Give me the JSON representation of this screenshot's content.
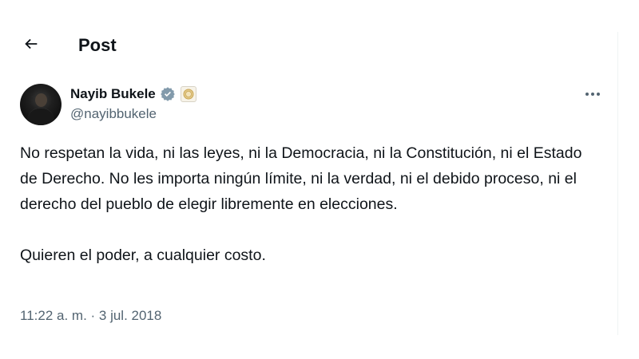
{
  "header": {
    "back_icon": "arrow-left-icon",
    "title": "Post"
  },
  "author": {
    "display_name": "Nayib Bukele",
    "handle": "@nayibbukele",
    "verified_icon": "verified-badge-icon",
    "verified_color": "#829aab",
    "affiliate_badge_icon": "affiliate-badge-icon"
  },
  "menu": {
    "more_icon": "more-horizontal-icon"
  },
  "tweet": {
    "paragraphs": [
      "No respetan la vida, ni las leyes, ni la Democracia, ni la Constitución, ni el Estado de Derecho. No les importa ningún límite, ni la verdad, ni el debido proceso, ni el derecho del pueblo de elegir libremente en elecciones.",
      "Quieren el poder, a cualquier costo."
    ],
    "timestamp": "11:22 a. m. · 3 jul. 2018"
  },
  "colors": {
    "text_primary": "#0f1419",
    "text_secondary": "#536471",
    "divider": "#eff3f4"
  }
}
